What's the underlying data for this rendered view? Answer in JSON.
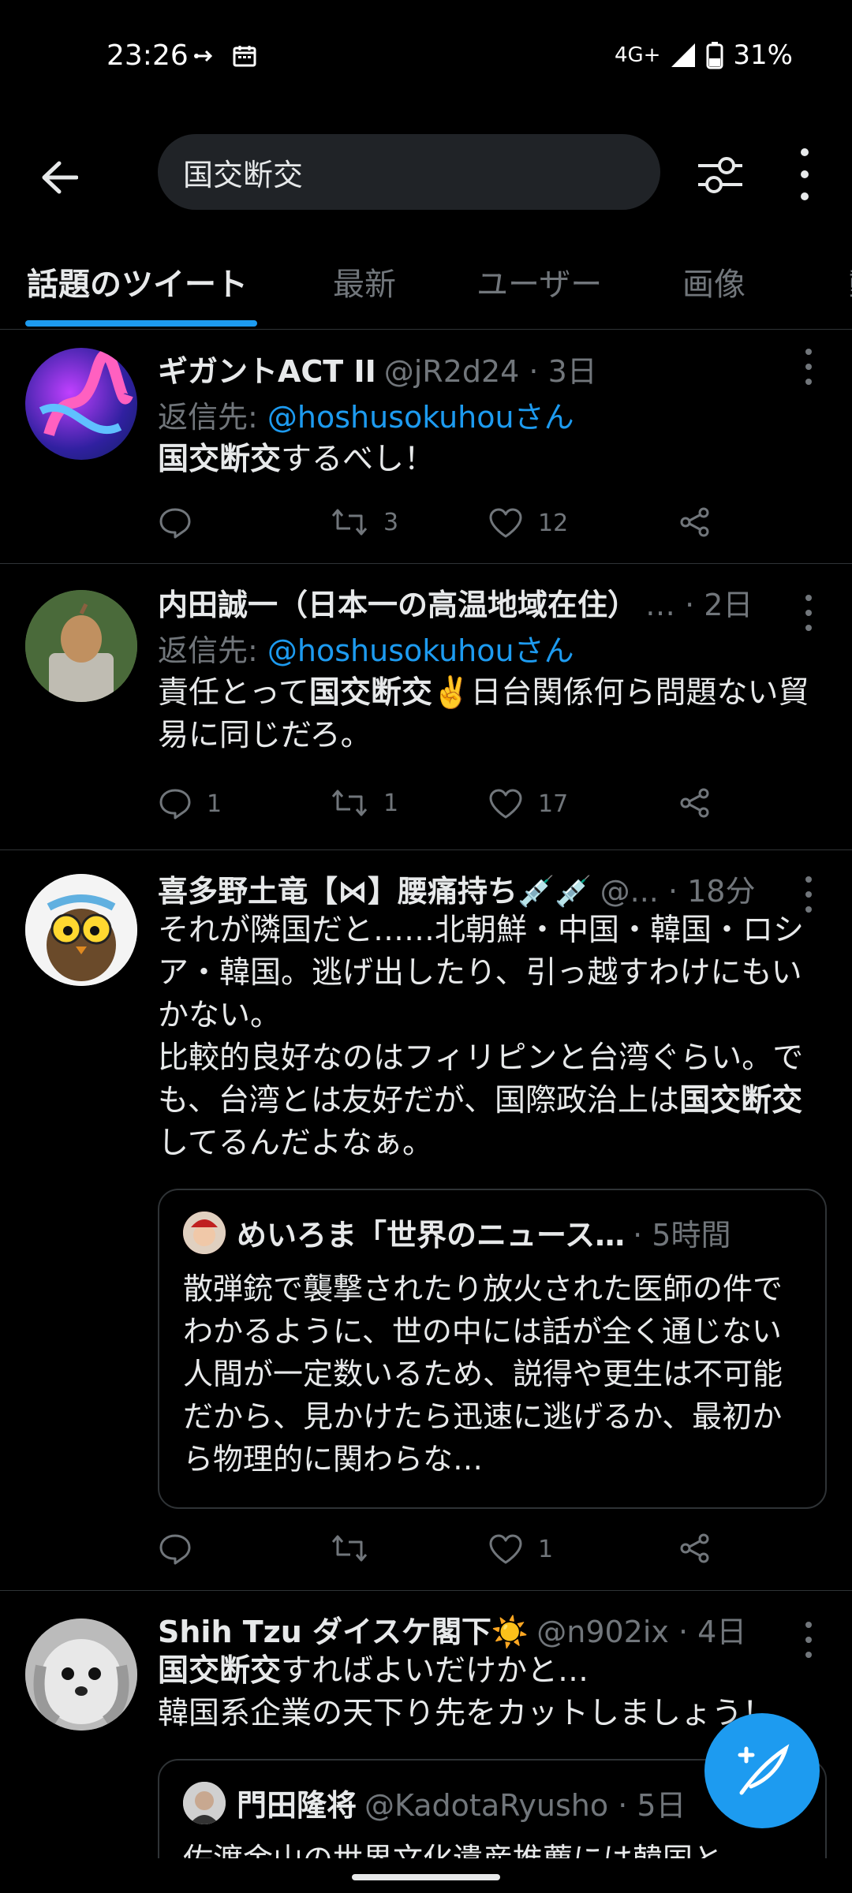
{
  "status_bar": {
    "time": "23:26",
    "network": "4G+",
    "battery": "31%"
  },
  "header": {
    "search_value": "国交断交"
  },
  "tabs": [
    "話題のツイート",
    "最新",
    "ユーザー",
    "画像",
    "動"
  ],
  "tweets": [
    {
      "name": "ギガントACT II",
      "meta": "@jR2d24 · 3日",
      "reply_prefix": "返信先: ",
      "reply_handle": "@hoshusokuhouさん",
      "body_bold": "国交断交",
      "body_rest": "するべし！",
      "reply_count": "",
      "retweet_count": "3",
      "like_count": "12"
    },
    {
      "name": "内田誠一（日本一の高温地域在住）",
      "meta": "… · 2日",
      "reply_prefix": "返信先: ",
      "reply_handle": "@hoshusokuhouさん",
      "body_pre": "責任とって",
      "body_bold": "国交断交",
      "body_rest": "✌️日台関係何ら問題ない貿易に同じだろ。",
      "reply_count": "1",
      "retweet_count": "1",
      "like_count": "17"
    },
    {
      "name": "喜多野土竜【⋈】腰痛持ち💉💉",
      "meta": "@... · 18分",
      "body_pre": "それが隣国だと……北朝鮮・中国・韓国・ロシア・韓国。逃げ出したり、引っ越すわけにもいかない。\n比較的良好なのはフィリピンと台湾ぐらい。でも、台湾とは友好だが、国際政治上は",
      "body_bold": "国交断交",
      "body_rest": "してるんだよなぁ。",
      "quote_name": "めいろま「世界のニュース…",
      "quote_meta": "· 5時間",
      "quote_body": "散弾銃で襲撃されたり放火された医師の件でわかるように、世の中には話が全く通じない人間が一定数いるため、説得や更生は不可能だから、見かけたら迅速に逃げるか、最初から物理的に関わらな…",
      "reply_count": "",
      "retweet_count": "",
      "like_count": "1"
    },
    {
      "name": "Shih Tzu ダイスケ閣下☀️",
      "meta": "@n902ix · 4日",
      "body_bold": "国交断交",
      "body_rest": "すればよいだけかと…\n韓国系企業の天下り先をカットしましょう！",
      "quote_name": "門田隆将",
      "quote_meta": "@KadotaRyusho · 5日",
      "quote_body": "佐渡金山の世界文化遺産推薦には韓国と"
    }
  ],
  "colors": {
    "accent": "#1d9bf0",
    "bg": "#000000",
    "muted": "#71767b",
    "divider": "#2f3336"
  }
}
